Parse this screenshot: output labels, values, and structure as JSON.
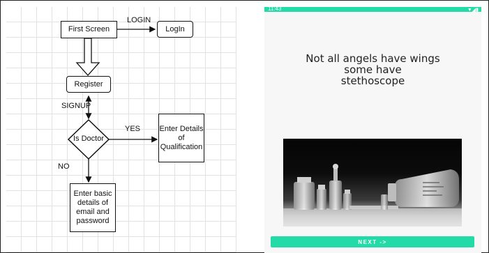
{
  "flowchart": {
    "nodes": {
      "first_screen": "First Screen",
      "login": "LogIn",
      "register": "Register",
      "is_doctor": "Is Doctor",
      "enter_details": [
        "Enter Details",
        "of",
        "Qualification"
      ],
      "enter_basic": [
        "Enter basic",
        "details of",
        "email and",
        "password"
      ]
    },
    "edge_labels": {
      "login": "LOGIN",
      "signup": "SIGNUP",
      "yes": "YES",
      "no": "NO"
    }
  },
  "phone": {
    "status_time": "11:43",
    "status_icons": "▼◢▮",
    "quote_lines": [
      "Not all angels have wings",
      "some have",
      "stethoscope"
    ],
    "image_icon": "medicine-bottles-photo",
    "next_button": "NEXT ->"
  },
  "colors": {
    "accent": "#22dba6",
    "background": "#f7f7f7",
    "grid": "#e2e2e2"
  }
}
